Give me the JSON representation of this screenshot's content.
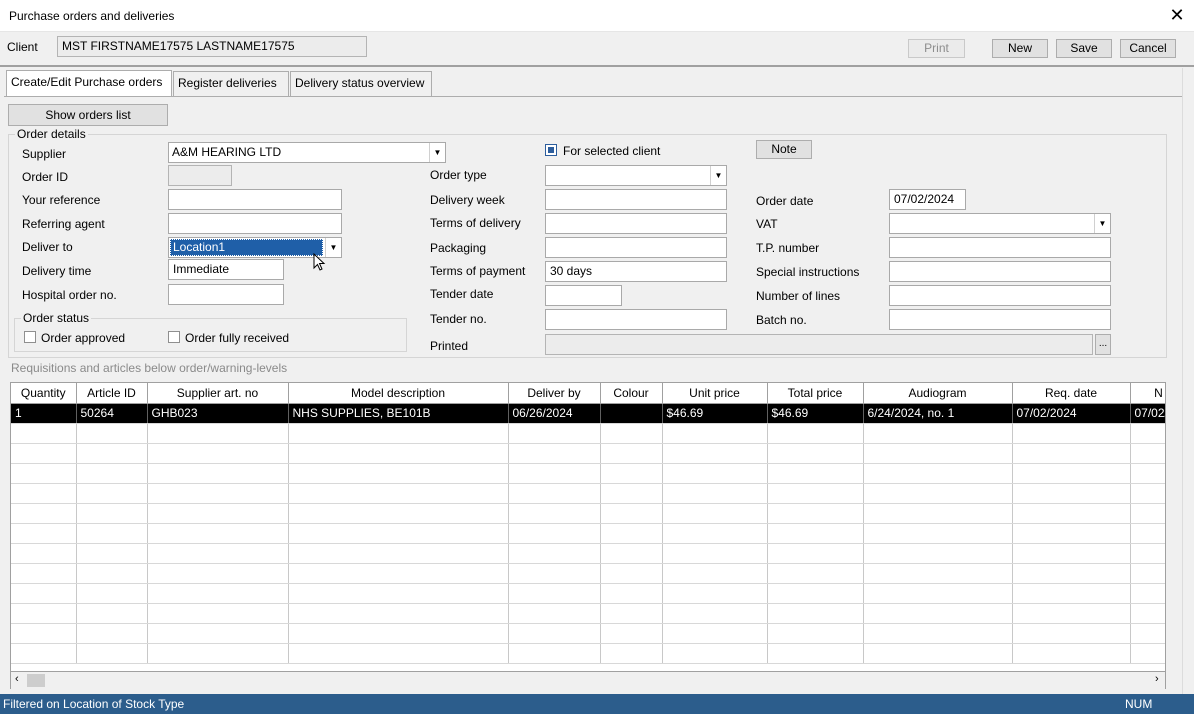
{
  "window": {
    "title": "Purchase orders and deliveries"
  },
  "client": {
    "label": "Client",
    "value": "MST FIRSTNAME17575 LASTNAME17575"
  },
  "toolbar": {
    "print": "Print",
    "new": "New",
    "save": "Save",
    "cancel": "Cancel"
  },
  "tabs": [
    "Create/Edit Purchase orders",
    "Register deliveries",
    "Delivery status overview"
  ],
  "show_orders_list": "Show orders list",
  "order_details": {
    "title": "Order details",
    "supplier_label": "Supplier",
    "supplier_value": "A&M HEARING LTD",
    "for_selected_client": "For selected client",
    "note": "Note",
    "order_id_label": "Order ID",
    "order_id_value": "",
    "your_reference_label": "Your reference",
    "your_reference_value": "",
    "referring_agent_label": "Referring agent",
    "referring_agent_value": "",
    "deliver_to_label": "Deliver to",
    "deliver_to_value": "Location1",
    "delivery_time_label": "Delivery time",
    "delivery_time_value": "Immediate",
    "hospital_order_label": "Hospital order no.",
    "hospital_order_value": "",
    "order_type_label": "Order type",
    "order_type_value": "",
    "delivery_week_label": "Delivery week",
    "delivery_week_value": "",
    "terms_delivery_label": "Terms of delivery",
    "terms_delivery_value": "",
    "packaging_label": "Packaging",
    "packaging_value": "",
    "terms_payment_label": "Terms of payment",
    "terms_payment_value": "30 days",
    "tender_date_label": "Tender date",
    "tender_date_value": "",
    "tender_no_label": "Tender no.",
    "tender_no_value": "",
    "printed_label": "Printed",
    "printed_value": "",
    "printed_button": "...",
    "order_date_label": "Order date",
    "order_date_value": "07/02/2024",
    "vat_label": "VAT",
    "vat_value": "",
    "tp_number_label": "T.P. number",
    "tp_number_value": "",
    "special_instructions_label": "Special instructions",
    "special_instructions_value": "",
    "number_of_lines_label": "Number of lines",
    "number_of_lines_value": "",
    "batch_no_label": "Batch no.",
    "batch_no_value": ""
  },
  "order_status": {
    "title": "Order status",
    "approved": "Order approved",
    "fully_received": "Order fully received"
  },
  "requisitions_label": "Requisitions and articles below order/warning-levels",
  "grid": {
    "columns": [
      "Quantity",
      "Article ID",
      "Supplier art. no",
      "Model description",
      "Deliver by",
      "Colour",
      "Unit price",
      "Total price",
      "Audiogram",
      "Req. date",
      "N"
    ],
    "rows": [
      [
        "1",
        "50264",
        "GHB023",
        "NHS SUPPLIES, BE101B",
        "06/26/2024",
        "",
        "$46.69",
        "$46.69",
        "6/24/2024, no. 1",
        "07/02/2024",
        "07/02/"
      ]
    ]
  },
  "status": {
    "text": "Filtered on Location of Stock Type",
    "num": "NUM"
  }
}
